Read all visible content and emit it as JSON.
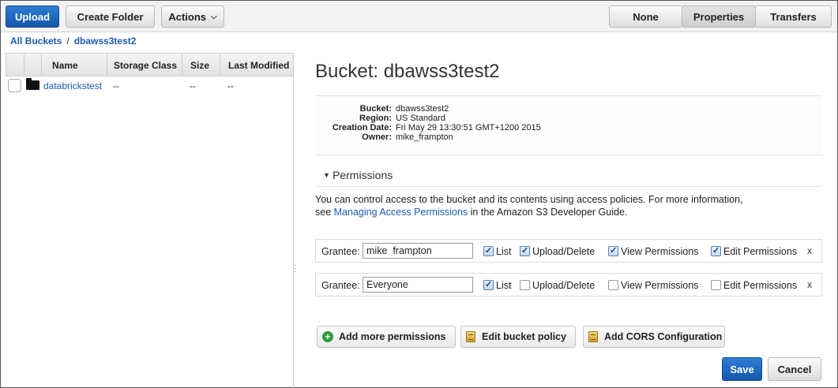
{
  "toolbar": {
    "upload": "Upload",
    "create_folder": "Create Folder",
    "actions": "Actions",
    "view_none": "None",
    "view_properties": "Properties",
    "view_transfers": "Transfers"
  },
  "breadcrumb": {
    "root": "All Buckets",
    "separator": "/",
    "current": "dbawss3test2"
  },
  "table": {
    "columns": [
      "Name",
      "Storage Class",
      "Size",
      "Last Modified"
    ],
    "rows": [
      {
        "name": "databrickstest",
        "storage_class": "--",
        "size": "--",
        "last_modified": "--",
        "icon": "folder-icon"
      }
    ]
  },
  "properties": {
    "heading": "Bucket: dbawss3test2",
    "details": [
      {
        "label": "Bucket:",
        "value": "dbawss3test2"
      },
      {
        "label": "Region:",
        "value": "US Standard"
      },
      {
        "label": "Creation Date:",
        "value": "Fri May 29 13:30:51 GMT+1200 2015"
      },
      {
        "label": "Owner:",
        "value": "mike_frampton"
      }
    ],
    "permissions_title": "Permissions",
    "perm_desc_1": "You can control access to the bucket and its contents using access policies. For more information,",
    "perm_desc_2_pre": "see ",
    "perm_desc_link": "Managing Access Permissions",
    "perm_desc_2_post": " in the Amazon S3 Developer Guide.",
    "grantee_label": "Grantee:",
    "grants": [
      {
        "grantee": "mike  frampton",
        "list": true,
        "upload_delete": true,
        "view_permissions": true,
        "edit_permissions": true
      },
      {
        "grantee": "Everyone",
        "list": true,
        "upload_delete": false,
        "view_permissions": false,
        "edit_permissions": false
      }
    ],
    "perm_labels": {
      "list": "List",
      "upload_delete": "Upload/Delete",
      "view_permissions": "View Permissions",
      "edit_permissions": "Edit Permissions"
    },
    "remove": "x",
    "add_more": "Add more permissions",
    "edit_policy": "Edit bucket policy",
    "add_cors": "Add CORS Configuration",
    "save": "Save",
    "cancel": "Cancel"
  },
  "colors": {
    "primary_button": "#1a63c0",
    "link": "#1a5bb0",
    "add_icon": "#2e9a3a"
  }
}
